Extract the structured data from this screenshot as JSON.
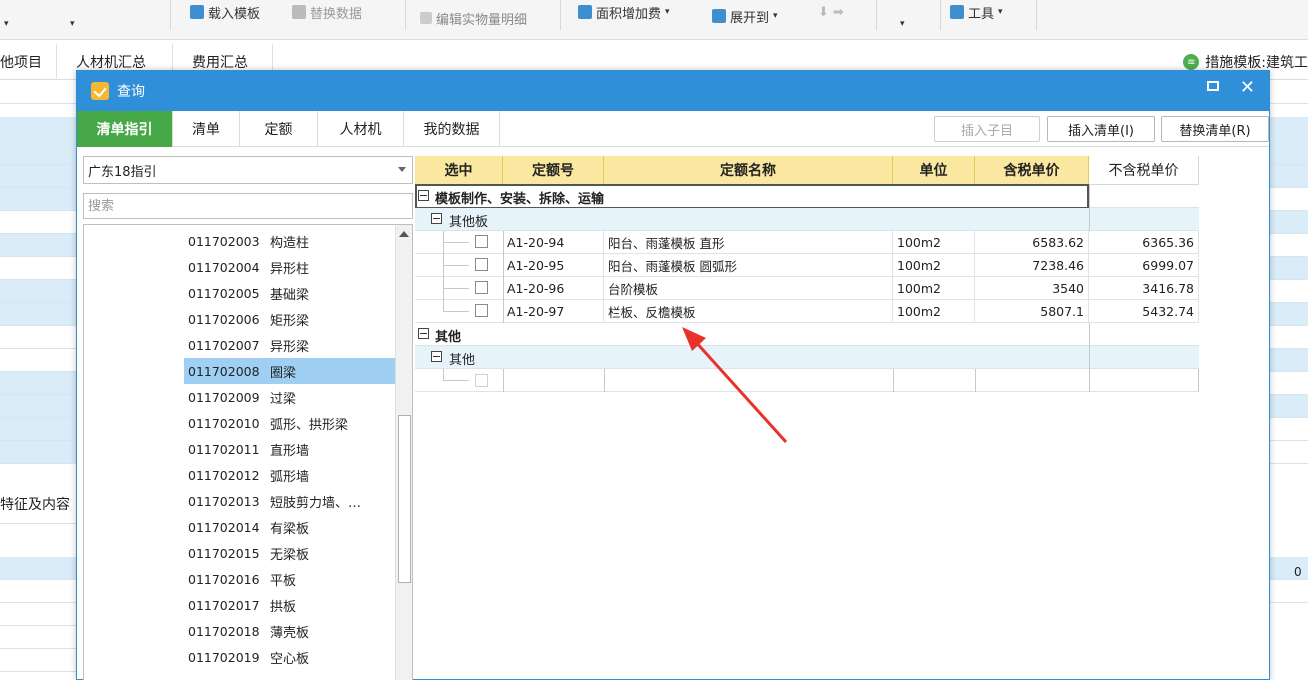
{
  "toolbar": {
    "load_template": "载入模板",
    "replace_data": "替换数据",
    "edit_detail": "编辑实物量明细",
    "area_add": "面积增加费",
    "expand_to": "展开到",
    "tools": "工具"
  },
  "app_tabs": {
    "other_items": "他项目",
    "labor_summary": "人材机汇总",
    "fee_summary": "费用汇总",
    "measure_template": "措施模板:建筑工"
  },
  "background": {
    "feature_label": "特征及内容",
    "zero_value": "0"
  },
  "dialog": {
    "title": "查询",
    "tabs": [
      "清单指引",
      "清单",
      "定额",
      "人材机",
      "我的数据"
    ],
    "buttons": {
      "insert_child": "插入子目",
      "insert_list": "插入清单(I)",
      "replace_list": "替换清单(R)"
    }
  },
  "left": {
    "select_value": "广东18指引",
    "search_placeholder": "搜索",
    "items": [
      {
        "code": "011702003",
        "name": "构造柱"
      },
      {
        "code": "011702004",
        "name": "异形柱"
      },
      {
        "code": "011702005",
        "name": "基础梁"
      },
      {
        "code": "011702006",
        "name": "矩形梁"
      },
      {
        "code": "011702007",
        "name": "异形梁"
      },
      {
        "code": "011702008",
        "name": "圈梁"
      },
      {
        "code": "011702009",
        "name": "过梁"
      },
      {
        "code": "011702010",
        "name": "弧形、拱形梁"
      },
      {
        "code": "011702011",
        "name": "直形墙"
      },
      {
        "code": "011702012",
        "name": "弧形墙"
      },
      {
        "code": "011702013",
        "name": "短肢剪力墙、…"
      },
      {
        "code": "011702014",
        "name": "有梁板"
      },
      {
        "code": "011702015",
        "name": "无梁板"
      },
      {
        "code": "011702016",
        "name": "平板"
      },
      {
        "code": "011702017",
        "name": "拱板"
      },
      {
        "code": "011702018",
        "name": "薄壳板"
      },
      {
        "code": "011702019",
        "name": "空心板"
      }
    ],
    "selected_index": 5
  },
  "grid": {
    "headers": {
      "select": "选中",
      "code": "定额号",
      "name": "定额名称",
      "unit": "单位",
      "price_tax": "含税单价",
      "price_notax": "不含税单价"
    },
    "group1": {
      "title": "模板制作、安装、拆除、运输",
      "sub": "其他板",
      "rows": [
        {
          "code": "A1-20-94",
          "name": "阳台、雨蓬模板 直形",
          "unit": "100m2",
          "price_tax": "6583.62",
          "price_notax": "6365.36"
        },
        {
          "code": "A1-20-95",
          "name": "阳台、雨蓬模板 圆弧形",
          "unit": "100m2",
          "price_tax": "7238.46",
          "price_notax": "6999.07"
        },
        {
          "code": "A1-20-96",
          "name": "台阶模板",
          "unit": "100m2",
          "price_tax": "3540",
          "price_notax": "3416.78"
        },
        {
          "code": "A1-20-97",
          "name": "栏板、反檐模板",
          "unit": "100m2",
          "price_tax": "5807.1",
          "price_notax": "5432.74"
        }
      ]
    },
    "group2": {
      "title": "其他",
      "sub": "其他"
    }
  },
  "colors": {
    "title_bar": "#2f8fd8",
    "active_tab": "#47a847",
    "header_yellow": "#fbe8a0",
    "selected_item": "#9fd0f4",
    "arrow": "#e8322a"
  }
}
